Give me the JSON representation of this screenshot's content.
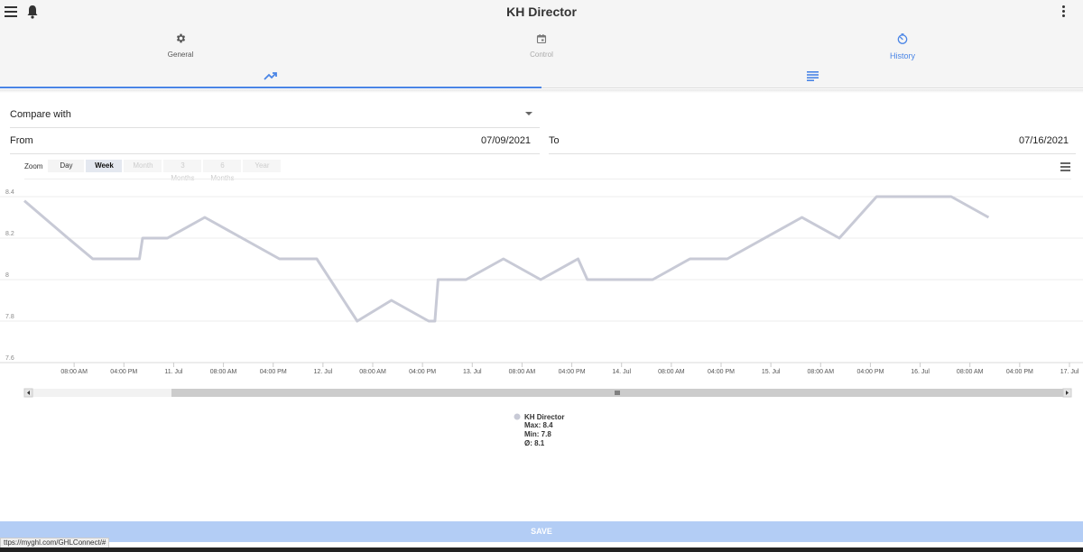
{
  "app": {
    "title": "KH Director"
  },
  "main_tabs": [
    {
      "label": "General",
      "icon": "gear-icon"
    },
    {
      "label": "Control",
      "icon": "calendar-icon"
    },
    {
      "label": "History",
      "icon": "history-icon"
    }
  ],
  "sub_tabs": [
    {
      "icon": "trending-up-icon"
    },
    {
      "icon": "list-icon"
    }
  ],
  "form": {
    "compare_label": "Compare with",
    "from_label": "From",
    "from_value": "07/09/2021",
    "to_label": "To",
    "to_value": "07/16/2021"
  },
  "zoom": {
    "label": "Zoom",
    "buttons": [
      "Day",
      "Week",
      "Month",
      "3 Months",
      "6 Months",
      "Year"
    ],
    "selected": "Week",
    "disabled": [
      "Month",
      "3 Months",
      "6 Months",
      "Year"
    ]
  },
  "colors": {
    "accent": "#4a85e6",
    "series": "#c8cad6",
    "save_bar": "#b3cdf5"
  },
  "chart_data": {
    "type": "line",
    "ylim": [
      7.6,
      8.5
    ],
    "y_ticks": [
      7.6,
      7.8,
      8,
      8.2,
      8.4
    ],
    "x_range_hours": [
      0,
      168
    ],
    "x_tick_labels": [
      "08:00 AM",
      "04:00 PM",
      "11. Jul",
      "08:00 AM",
      "04:00 PM",
      "12. Jul",
      "08:00 AM",
      "04:00 PM",
      "13. Jul",
      "08:00 AM",
      "04:00 PM",
      "14. Jul",
      "08:00 AM",
      "04:00 PM",
      "15. Jul",
      "08:00 AM",
      "04:00 PM",
      "16. Jul",
      "08:00 AM",
      "04:00 PM",
      "17. Jul"
    ],
    "series": [
      {
        "name": "KH Director",
        "points": [
          [
            0,
            8.38
          ],
          [
            7,
            8.2
          ],
          [
            11,
            8.1
          ],
          [
            18.5,
            8.1
          ],
          [
            19,
            8.2
          ],
          [
            23,
            8.2
          ],
          [
            29,
            8.3
          ],
          [
            41,
            8.1
          ],
          [
            47,
            8.1
          ],
          [
            53.5,
            7.8
          ],
          [
            59,
            7.9
          ],
          [
            65,
            7.8
          ],
          [
            66,
            7.8
          ],
          [
            66.5,
            8.0
          ],
          [
            71,
            8.0
          ],
          [
            77,
            8.1
          ],
          [
            83,
            8.0
          ],
          [
            89,
            8.1
          ],
          [
            90.5,
            8.0
          ],
          [
            101,
            8.0
          ],
          [
            107,
            8.1
          ],
          [
            113,
            8.1
          ],
          [
            125,
            8.3
          ],
          [
            131,
            8.2
          ],
          [
            137,
            8.4
          ],
          [
            149,
            8.4
          ],
          [
            155,
            8.3
          ]
        ]
      }
    ],
    "legend": {
      "name": "KH Director",
      "max": "Max: 8.4",
      "min": "Min: 7.8",
      "avg": "Ø: 8.1"
    }
  },
  "save_label": "SAVE",
  "status_url": "ttps://myghl.com/GHLConnect/#"
}
